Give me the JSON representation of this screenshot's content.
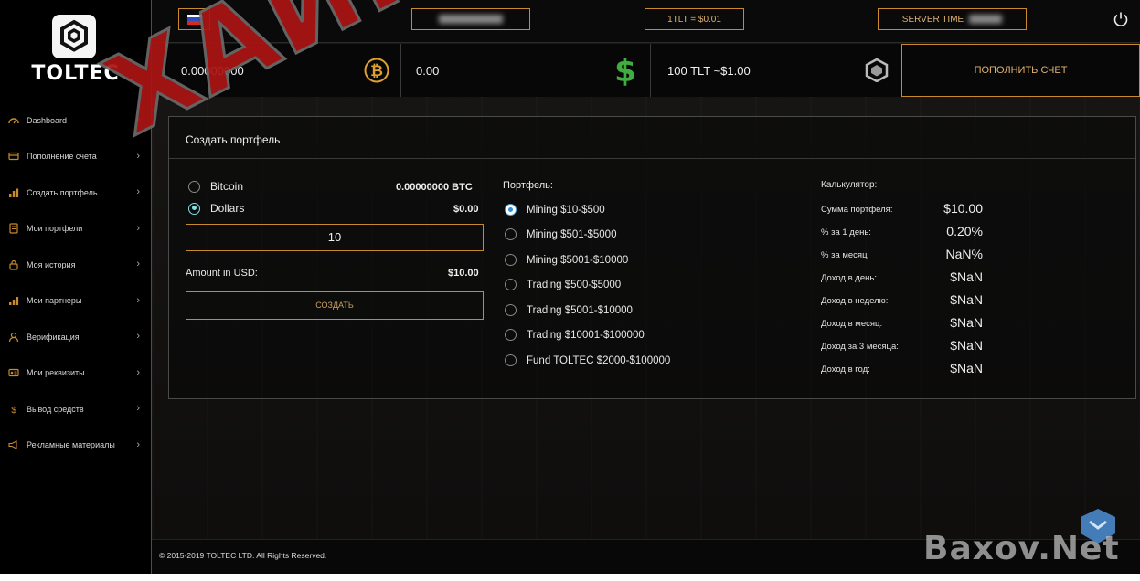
{
  "brand": {
    "name": "TOLTEC"
  },
  "sidebar": {
    "items": [
      {
        "label": "Dashboard",
        "icon": "dashboard-icon"
      },
      {
        "label": "Пополнение счета",
        "icon": "card-icon"
      },
      {
        "label": "Создать портфель",
        "icon": "chart-icon"
      },
      {
        "label": "Мои портфели",
        "icon": "wallet-icon"
      },
      {
        "label": "Моя история",
        "icon": "lock-icon"
      },
      {
        "label": "Мои партнеры",
        "icon": "bars-icon"
      },
      {
        "label": "Верификация",
        "icon": "user-icon"
      },
      {
        "label": "Мои реквизиты",
        "icon": "id-card-icon"
      },
      {
        "label": "Вывод средств",
        "icon": "dollar-icon"
      },
      {
        "label": "Рекламные материалы",
        "icon": "megaphone-icon"
      }
    ]
  },
  "topbar": {
    "rate": "1TLT = $0.01",
    "server_time_label": "SERVER TIME",
    "language": "ru"
  },
  "stats": {
    "btc_balance": "0.00000000",
    "usd_balance": "0.00",
    "tlt_balance": "100 TLT ~$1.00",
    "deposit_button": "ПОПОЛНИТЬ СЧЕТ"
  },
  "panel": {
    "title": "Создать портфель",
    "currency_options": [
      {
        "label": "Bitcoin",
        "value": "0.00000000 BTC",
        "selected": false
      },
      {
        "label": "Dollars",
        "value": "$0.00",
        "selected": true
      }
    ],
    "amount_input": "10",
    "amount_label": "Amount in USD:",
    "amount_value": "$10.00",
    "create_button": "СОЗДАТЬ",
    "portfolio_label": "Портфель:",
    "portfolios": [
      {
        "label": "Mining $10-$500",
        "selected": true
      },
      {
        "label": "Mining $501-$5000",
        "selected": false
      },
      {
        "label": "Mining $5001-$10000",
        "selected": false
      },
      {
        "label": "Trading $500-$5000",
        "selected": false
      },
      {
        "label": "Trading $5001-$10000",
        "selected": false
      },
      {
        "label": "Trading $10001-$100000",
        "selected": false
      },
      {
        "label": "Fund TOLTEC $2000-$100000",
        "selected": false
      }
    ],
    "calculator": {
      "title": "Калькулятор:",
      "rows": [
        {
          "label": "Сумма портфеля:",
          "value": "$10.00"
        },
        {
          "label": "% за 1 день:",
          "value": "0.20%"
        },
        {
          "label": "% за месяц",
          "value": "NaN%"
        },
        {
          "label": "Доход в день:",
          "value": "$NaN"
        },
        {
          "label": "Доход в неделю:",
          "value": "$NaN"
        },
        {
          "label": "Доход в месяц:",
          "value": "$NaN"
        },
        {
          "label": "Доход за 3 месяца:",
          "value": "$NaN"
        },
        {
          "label": "Доход в год:",
          "value": "$NaN"
        }
      ]
    }
  },
  "footer": {
    "copyright": "© 2015-2019 TOLTEC LTD. All Rights Reserved."
  },
  "overlay": {
    "stamp_text": "ХАЙП ПРОСТО ХАЙП",
    "watermark": "Baxov.Net"
  },
  "colors": {
    "accent": "#c88a2a",
    "stamp": "#ab1414",
    "btc": "#e0a030",
    "usd": "#3fae3f"
  }
}
